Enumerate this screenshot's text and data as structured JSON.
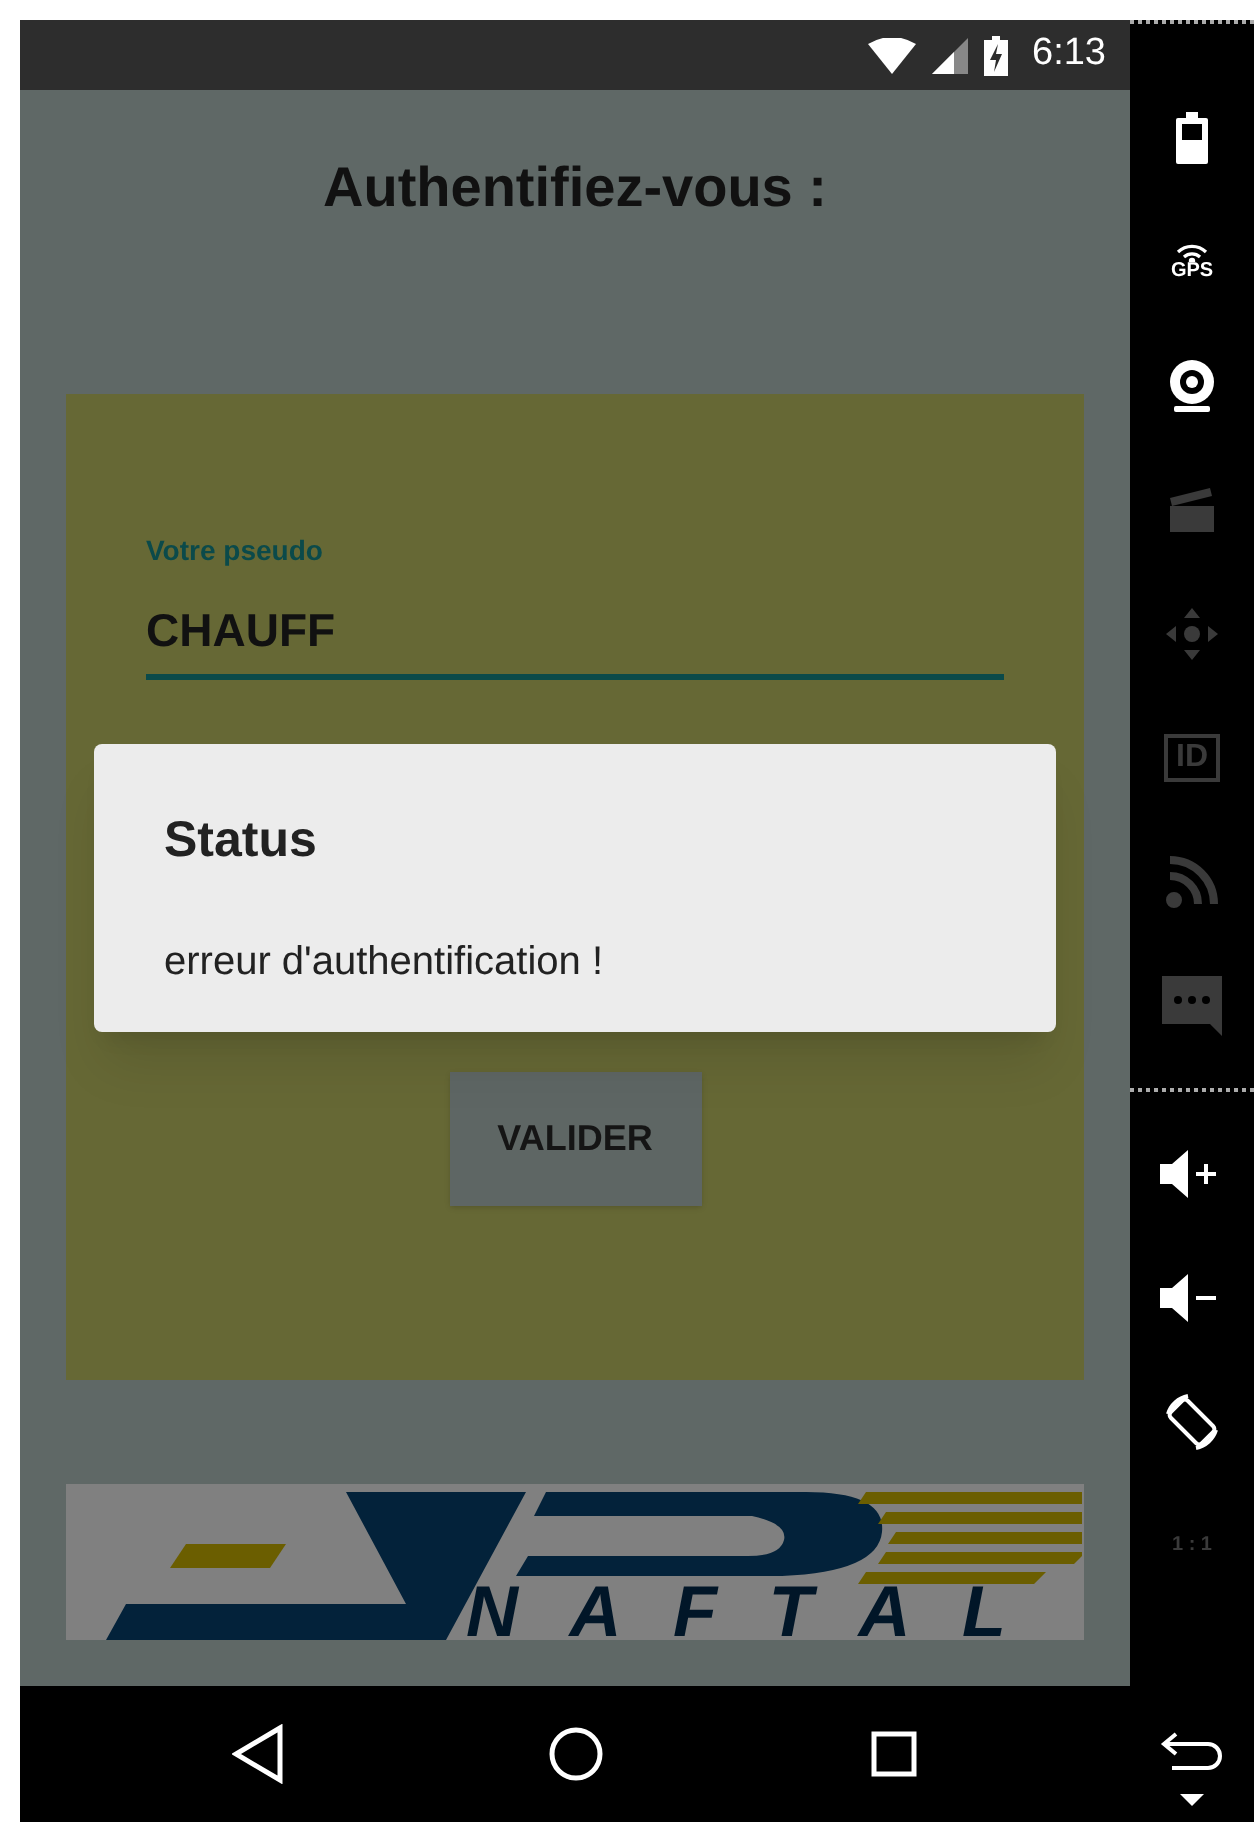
{
  "status_bar": {
    "time": "6:13"
  },
  "title": "Authentifiez-vous :",
  "form": {
    "field": {
      "label": "Votre pseudo",
      "value": "CHAUFF",
      "focused": true
    },
    "submit": "VALIDER"
  },
  "dialog": {
    "title": "Status",
    "message": "erreur d'authentification !"
  },
  "logo": {
    "text": "NAFTAL"
  },
  "side_panel": [
    {
      "kind": "battery",
      "disabled": false
    },
    {
      "kind": "gps",
      "label": "GPS",
      "disabled": false
    },
    {
      "kind": "webcam",
      "disabled": false
    },
    {
      "kind": "clapper",
      "disabled": true
    },
    {
      "kind": "dpad",
      "disabled": true
    },
    {
      "kind": "id",
      "label": "ID",
      "disabled": true
    },
    {
      "kind": "rss",
      "disabled": true
    },
    {
      "kind": "message",
      "disabled": true
    },
    {
      "kind": "separator"
    },
    {
      "kind": "volume_up",
      "disabled": false
    },
    {
      "kind": "volume_down",
      "disabled": false
    },
    {
      "kind": "rotate",
      "disabled": false
    },
    {
      "kind": "scale",
      "label": "1 : 1",
      "disabled": true
    }
  ],
  "nav_bar": [
    {
      "kind": "back"
    },
    {
      "kind": "home"
    },
    {
      "kind": "recents"
    }
  ]
}
